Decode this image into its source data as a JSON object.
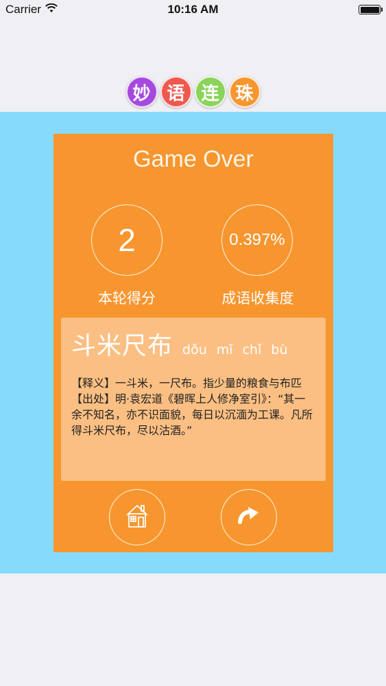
{
  "status_bar": {
    "carrier": "Carrier",
    "time": "10:16 AM",
    "wifi_icon": "wifi-icon",
    "battery_icon": "battery-icon"
  },
  "logo": {
    "chars": [
      {
        "text": "妙",
        "color": "#a649df"
      },
      {
        "text": "语",
        "color": "#f0574d"
      },
      {
        "text": "连",
        "color": "#8bd35a"
      },
      {
        "text": "珠",
        "color": "#f7962f"
      }
    ]
  },
  "colors": {
    "background": "#efeff4",
    "blue_band": "#86dbfd",
    "card": "#f7962f",
    "panel": "#fbbf83"
  },
  "result": {
    "title": "Game Over",
    "score": "2",
    "score_label": "本轮得分",
    "collection_rate": "0.397%",
    "collection_label": "成语收集度"
  },
  "idiom": {
    "word": "斗米尺布",
    "pinyin": "dǒu mǐ chǐ bù",
    "meaning": "【释义】一斗米，一尺布。指少量的粮食与布匹",
    "source": "【出处】明·袁宏道《碧晖上人修净室引》：“其一余不知名，亦不识面貌，每日以沉湎为工课。凡所得斗米尺布，尽以沽酒。”"
  },
  "buttons": {
    "home_icon": "home-icon",
    "next_icon": "curved-arrow-icon"
  }
}
